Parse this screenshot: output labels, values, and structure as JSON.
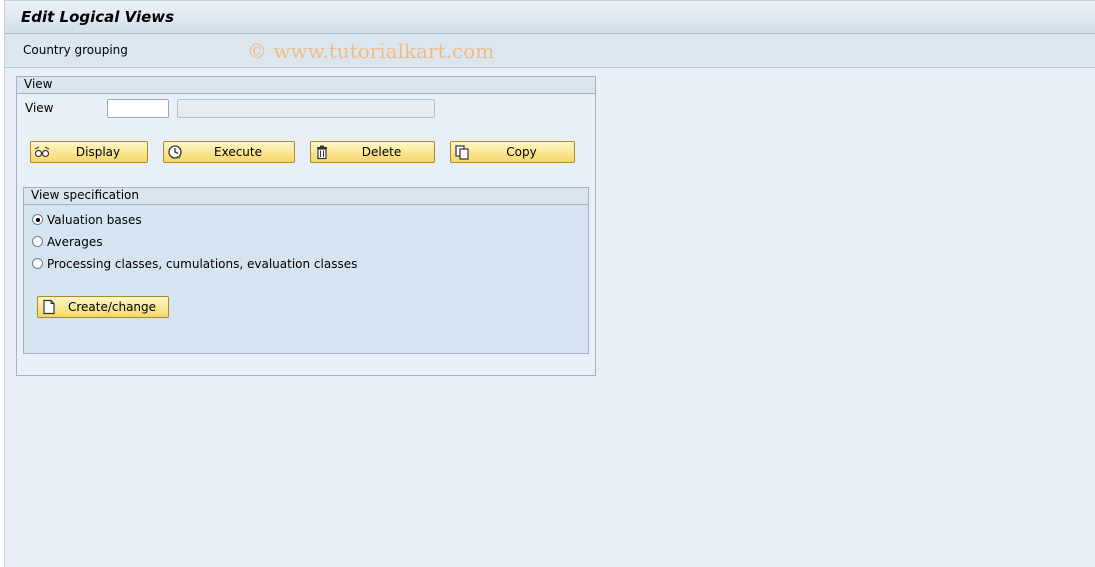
{
  "window": {
    "title": "Edit Logical Views"
  },
  "appbar": {
    "menu_item": "Country grouping",
    "watermark": "© www.tutorialkart.com"
  },
  "view_group": {
    "title": "View",
    "field_label": "View",
    "field_value": "",
    "description_value": "",
    "buttons": {
      "display": "Display",
      "execute": "Execute",
      "delete": "Delete",
      "copy": "Copy"
    }
  },
  "spec_group": {
    "title": "View specification",
    "options": [
      {
        "label": "Valuation bases",
        "selected": true
      },
      {
        "label": "Averages",
        "selected": false
      },
      {
        "label": "Processing classes, cumulations, evaluation classes",
        "selected": false
      }
    ],
    "create_change_label": "Create/change"
  },
  "colors": {
    "button_fill": "#f5d769",
    "background": "#e9eff6",
    "watermark": "#f2bb86"
  },
  "icons": [
    "display-glasses-icon",
    "execute-clock-icon",
    "delete-trash-icon",
    "copy-pages-icon",
    "new-document-icon"
  ]
}
